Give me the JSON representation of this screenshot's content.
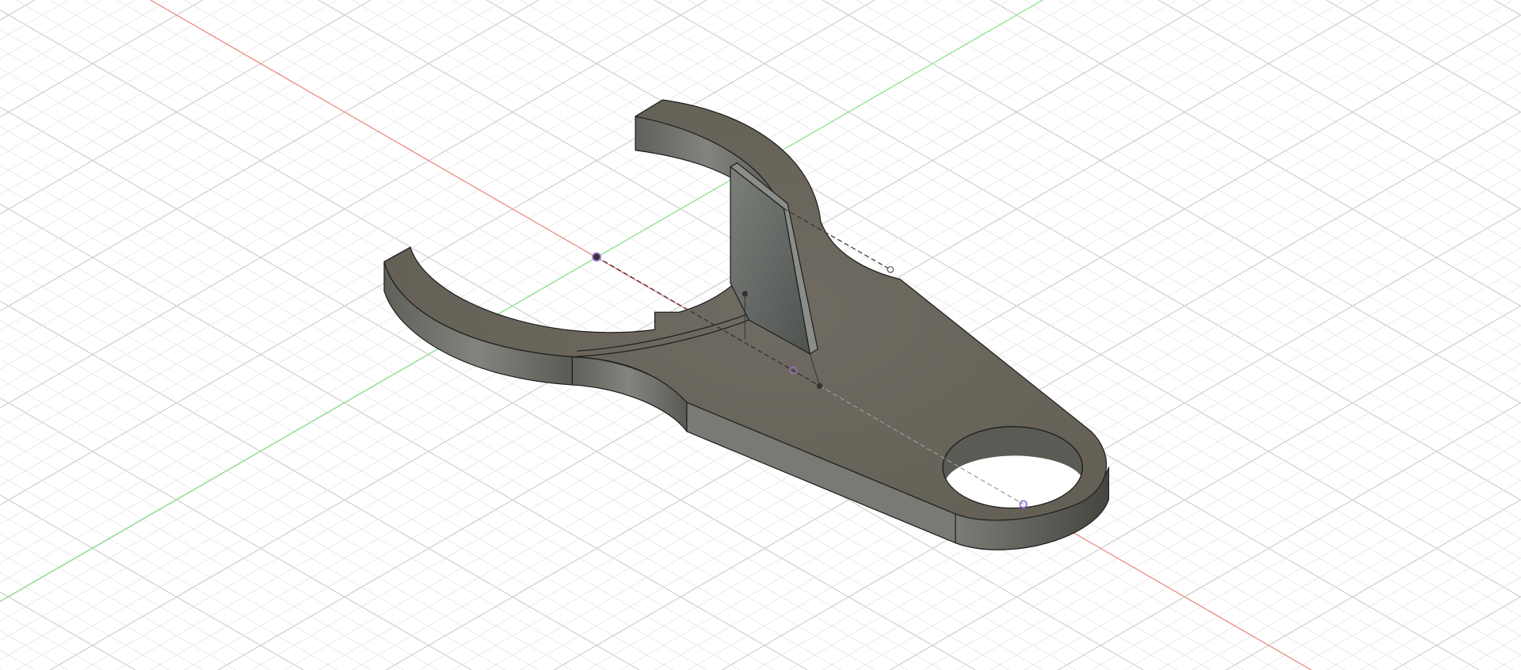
{
  "viewport": {
    "background": "#ffffff",
    "grid_minor_color": "#e6e6e6",
    "grid_major_color": "#cfcfcf",
    "x_axis_color": "#f28b82",
    "y_axis_color": "#8ee68e"
  },
  "model": {
    "top_face_color": "#6b665c",
    "wall_light_color": "#7d7f78",
    "wall_dark_color": "#55554f",
    "edge_color": "#1e1e1e",
    "sketch_point_color": "#9b6fd6"
  },
  "icons": [
    "origin-point-icon",
    "sketch-point-icon"
  ]
}
